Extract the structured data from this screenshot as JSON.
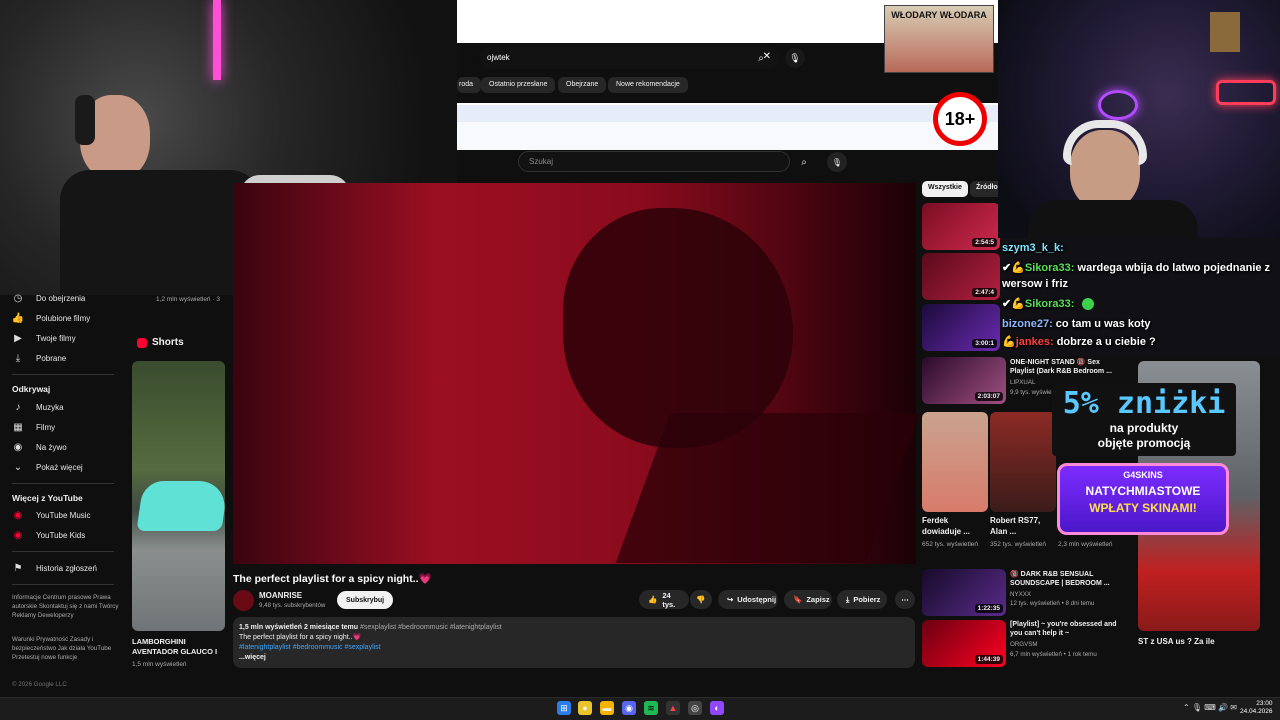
{
  "top_search": {
    "query": "ojwtek",
    "chips": [
      "roda",
      "Ostatnio przesłane",
      "Obejrzane",
      "Nowe rekomendacje"
    ]
  },
  "banner": {
    "text": "WŁODARY WŁODARA"
  },
  "age_badge": "18+",
  "main_search": {
    "placeholder": "Szukaj"
  },
  "sidebar": {
    "top_items": [
      {
        "icon": "history-icon",
        "label": "Do obejrzenia"
      },
      {
        "icon": "thumbs-up-icon",
        "label": "Polubione filmy"
      },
      {
        "icon": "video-icon",
        "label": "Twoje filmy"
      },
      {
        "icon": "download-icon",
        "label": "Pobrane"
      }
    ],
    "explore_heading": "Odkrywaj",
    "explore_items": [
      {
        "icon": "music-icon",
        "label": "Muzyka"
      },
      {
        "icon": "film-icon",
        "label": "Filmy"
      },
      {
        "icon": "live-icon",
        "label": "Na żywo"
      },
      {
        "icon": "chevron-down-icon",
        "label": "Pokaż więcej"
      }
    ],
    "more_heading": "Więcej z YouTube",
    "more_items": [
      {
        "icon": "youtube-music-icon",
        "label": "YouTube Music"
      },
      {
        "icon": "youtube-kids-icon",
        "label": "YouTube Kids"
      }
    ],
    "report_item": {
      "icon": "flag-icon",
      "label": "Historia zgłoszeń"
    },
    "footer1": "Informacje Centrum prasowe Prawa autorskie Skontaktuj się z nami Twórcy Reklamy Deweloperzy",
    "footer2": "Warunki Prywatność Zasady i bezpieczeństwo Jak działa YouTube Przetestuj nowe funkcje",
    "copyright": "© 2026 Google LLC"
  },
  "left_col": {
    "views": "1,2 mln wyświetleń · 3",
    "shorts_label": "Shorts",
    "short_title": "LAMBORGHINI AVENTADOR GLAUCO I",
    "short_views": "1,5 mln wyświetleń"
  },
  "video": {
    "title": "The perfect playlist for a spicy night..💗",
    "channel": "MOANRISE",
    "subs": "9,48 tys. subskrybentów",
    "subscribe": "Subskrybuj",
    "likes": "24 tys.",
    "share": "Udostępnij",
    "save": "Zapisz",
    "download": "Pobierz",
    "desc_meta": "1,5 mln wyświetleń  2 miesiące temu",
    "desc_tags1": "#sexplaylist #bedroommusic #latenightplaylist",
    "desc_line": "The perfect playlist for a spicy night..💗",
    "desc_tags2": "#latenightplaylist #bedroommusic #sexplaylist",
    "more": "...więcej"
  },
  "filter_chips": [
    "Wszystkie",
    "Źródło"
  ],
  "recs": [
    {
      "duration": "2:54:5",
      "title": "",
      "meta": ""
    },
    {
      "duration": "2:47:4",
      "title": "",
      "meta": ""
    },
    {
      "duration": "3:00:1",
      "title": "",
      "meta": ""
    },
    {
      "duration": "2:03:07",
      "title": "ONE-NIGHT STAND 🔞 Sex Playlist (Dark R&B Bedroom ...",
      "channel": "LIPXUAL",
      "meta": "9,9 tys. wyświetleń"
    },
    {
      "duration": "1:22:35",
      "title": "🔞 DARK R&B SENSUAL SOUNDSCAPE | BEDROOM ...",
      "channel": "NYXXX",
      "meta": "12 tys. wyświetleń • 8 dni temu"
    },
    {
      "duration": "1:44:39",
      "title": "[Playlist] ~ you're obsessed and you can't help it ~",
      "channel": "ORGVSM",
      "meta": "6,7 mln wyświetleń • 1 rok temu"
    }
  ],
  "shorts_row": [
    {
      "title": "Ferdek dowiaduje ...",
      "views": "652 tys. wyświetleń"
    },
    {
      "title": "Robert RS77, Alan ...",
      "views": "352 tys. wyświetleń"
    },
    {
      "title": "",
      "views": "2,3 mln wyświetleń"
    }
  ],
  "right_short": {
    "title": "ST z USA us ? Za ile"
  },
  "chat": [
    {
      "user": "szym3_k_k:",
      "text": "",
      "color": "#7fe3ff"
    },
    {
      "user": "Sikora33:",
      "text": "wardega wbija do latwo pojednanie z wersow i friz",
      "color": "#56e05a"
    },
    {
      "user": "Sikora33:",
      "text": "",
      "color": "#56e05a"
    },
    {
      "user": "bizone27:",
      "text": "co tam u was koty",
      "color": "#8fb8ff"
    },
    {
      "user": "jankes:",
      "text": "dobrze a u ciebie ?",
      "color": "#ff4040"
    }
  ],
  "promo": {
    "big": "5% zniżki",
    "line1": "na produkty",
    "line2": "objęte promocją",
    "brand": "G4SKINS",
    "cta1": "NATYCHMIASTOWE",
    "cta2": "WPŁATY SKINAMI!"
  },
  "clock": {
    "time": "23:00",
    "date": "24.04.2026"
  },
  "colors": {
    "accent": "#ff0033",
    "video_red": "#9c0f22",
    "chip_bg": "#272727"
  }
}
